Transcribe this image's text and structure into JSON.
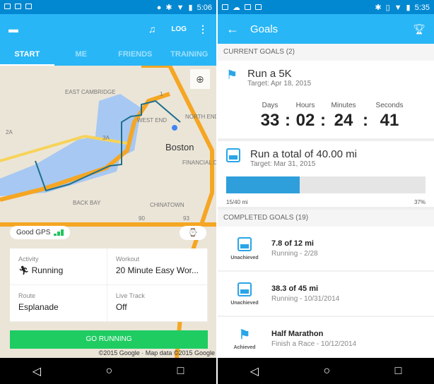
{
  "left": {
    "status": {
      "time": "5:06"
    },
    "toolbar": {
      "log_label": "LOG",
      "icons": [
        "chat-icon",
        "music-icon",
        "more-icon"
      ]
    },
    "tabs": [
      "START",
      "ME",
      "FRIENDS",
      "TRAINING"
    ],
    "map": {
      "labels": [
        "EAST CAMBRIDGE",
        "WEST END",
        "Boston",
        "NORTH END",
        "FINANCIAL DISTRICT",
        "BACK BAY",
        "CHINATOWN",
        "3A",
        "2A",
        "1",
        "90",
        "93"
      ]
    },
    "gps": {
      "label": "Good GPS"
    },
    "card": {
      "activity_label": "Activity",
      "activity_value": "Running",
      "workout_label": "Workout",
      "workout_value": "20 Minute Easy Wor...",
      "route_label": "Route",
      "route_value": "Esplanade",
      "live_label": "Live Track",
      "live_value": "Off"
    },
    "go_label": "GO RUNNING",
    "copyright": "©2015 Google · Map data ©2015 Google"
  },
  "right": {
    "status": {
      "time": "5:35"
    },
    "toolbar": {
      "title": "Goals"
    },
    "current_header": "CURRENT GOALS (2)",
    "goal1": {
      "title": "Run a 5K",
      "target": "Target: Apr 18, 2015",
      "labels": [
        "Days",
        "Hours",
        "Minutes",
        "Seconds"
      ],
      "values": [
        "33",
        "02",
        "24",
        "41"
      ],
      "sep": ":"
    },
    "goal2": {
      "title": "Run a total of 40.00 mi",
      "target": "Target: Mar 31, 2015",
      "progress_text": "15/40 mi",
      "percent": "37%",
      "progress": 37
    },
    "completed_header": "COMPLETED GOALS (19)",
    "completed": [
      {
        "status": "Unachieved",
        "title": "7.8 of 12 mi",
        "sub": "Running - 2/28",
        "icon": "chart-icon"
      },
      {
        "status": "Unachieved",
        "title": "38.3 of 45 mi",
        "sub": "Running - 10/31/2014",
        "icon": "chart-icon"
      },
      {
        "status": "Achieved",
        "title": "Half Marathon",
        "sub": "Finish a Race - 10/12/2014",
        "icon": "flag-icon"
      }
    ]
  }
}
